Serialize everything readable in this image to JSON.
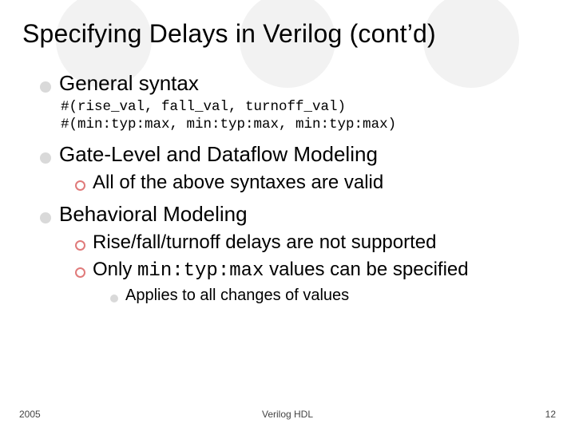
{
  "title": "Specifying Delays in Verilog (cont’d)",
  "sections": [
    {
      "heading": "General syntax",
      "code": "#(rise_val, fall_val, turnoff_val)\n#(min:typ:max, min:typ:max, min:typ:max)"
    },
    {
      "heading": "Gate-Level and Dataflow Modeling",
      "sub": [
        {
          "text": "All of the above syntaxes are valid"
        }
      ]
    },
    {
      "heading": "Behavioral Modeling",
      "sub": [
        {
          "text": "Rise/fall/turnoff delays are not supported"
        },
        {
          "prefix": "Only ",
          "mono": "min:typ:max",
          "suffix": " values can be specified",
          "subsub": [
            {
              "text": "Applies to all changes of values"
            }
          ]
        }
      ]
    }
  ],
  "footer": {
    "left": "2005",
    "center": "Verilog HDL",
    "right": "12"
  }
}
